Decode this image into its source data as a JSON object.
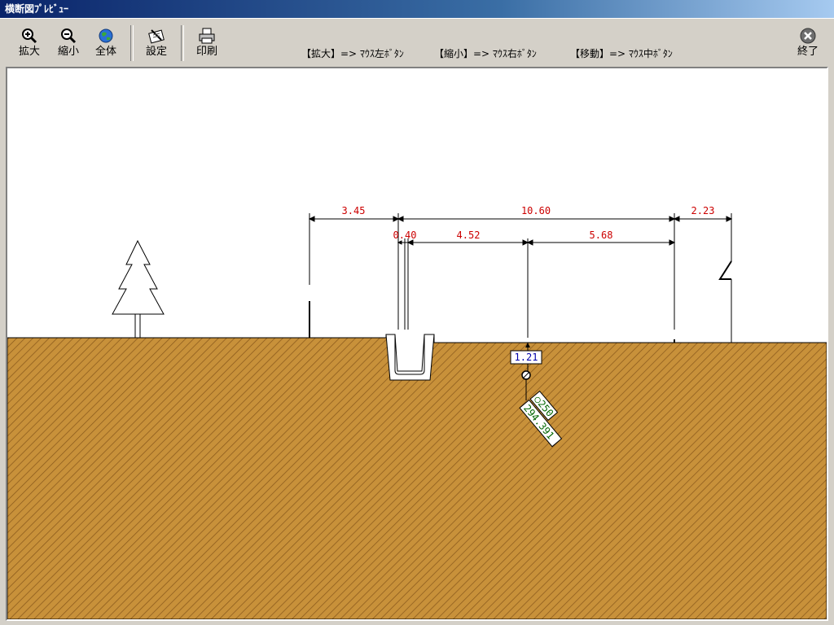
{
  "window": {
    "title": "横断図ﾌﾟﾚﾋﾞｭｰ"
  },
  "toolbar": {
    "zoom_in": "拡大",
    "zoom_out": "縮小",
    "fit_all": "全体",
    "settings": "設定",
    "print": "印刷",
    "exit": "終了"
  },
  "hints": {
    "zoom_in": "【拡大】=> ﾏｳｽ左ﾎﾞﾀﾝ",
    "zoom_out": "【縮小】=> ﾏｳｽ右ﾎﾞﾀﾝ",
    "pan": "【移動】=> ﾏｳｽ中ﾎﾞﾀﾝ"
  },
  "drawing": {
    "dimensions": {
      "d1": "3.45",
      "d2": "10.60",
      "d3": "2.23",
      "d4": "0.40",
      "d5": "4.52",
      "d6": "5.68"
    },
    "depth_label": "1.21",
    "pipe_size": "○250",
    "pipe_station": "294.391"
  },
  "colors": {
    "ground": "#c8913a",
    "hatch": "#8a5a1c",
    "dimension_text": "#cc0000",
    "depth_text": "#0000aa",
    "pipe_text": "#006600"
  },
  "icons": [
    "zoom-in-icon",
    "zoom-out-icon",
    "globe-icon",
    "settings-icon",
    "printer-icon",
    "close-icon"
  ]
}
